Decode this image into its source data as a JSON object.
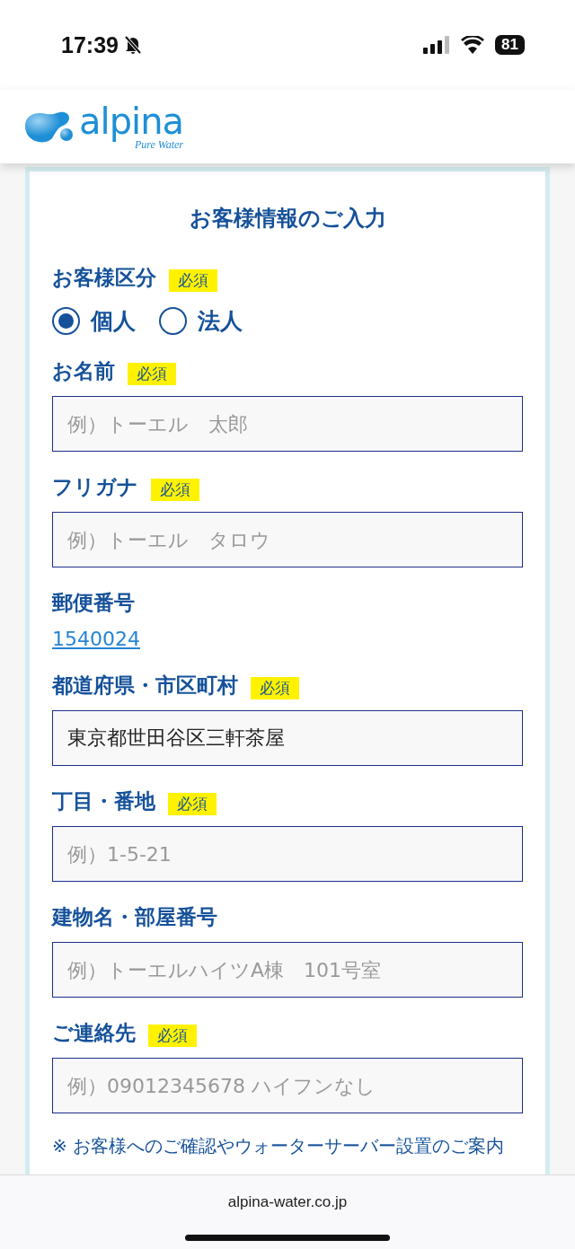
{
  "status_bar": {
    "time": "17:39",
    "muted": true,
    "battery": "81"
  },
  "header": {
    "logo_name": "alpina",
    "logo_tagline": "Pure Water"
  },
  "form": {
    "title": "お客様情報のご入力",
    "fields": [
      {
        "kind": "radio",
        "label": "お客様区分",
        "badge": "必須",
        "options": [
          {
            "label": "個人",
            "selected": true
          },
          {
            "label": "法人",
            "selected": false
          }
        ]
      },
      {
        "kind": "input",
        "label": "お名前",
        "badge": "必須",
        "placeholder": "例）トーエル　太郎"
      },
      {
        "kind": "input",
        "label": "フリガナ",
        "badge": "必須",
        "placeholder": "例）トーエル　タロウ"
      },
      {
        "kind": "link",
        "label": "郵便番号",
        "value": "1540024"
      },
      {
        "kind": "input",
        "label": "都道府県・市区町村",
        "badge": "必須",
        "value": "東京都世田谷区三軒茶屋"
      },
      {
        "kind": "input",
        "label": "丁目・番地",
        "badge": "必須",
        "placeholder": "例）1-5-21"
      },
      {
        "kind": "input",
        "label": "建物名・部屋番号",
        "placeholder": "例）トーエルハイツA棟　101号室"
      },
      {
        "kind": "input",
        "label": "ご連絡先",
        "badge": "必須",
        "placeholder": "例）09012345678 ハイフンなし"
      }
    ],
    "note": "※ お客様へのご確認やウォーターサーバー設置のご案内"
  },
  "browser_bar": {
    "url": "alpina-water.co.jp"
  }
}
